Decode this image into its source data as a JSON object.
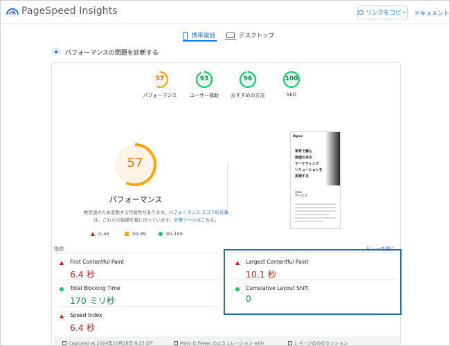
{
  "header": {
    "app_title": "PageSpeed Insights",
    "copy_link_label": "リンクをコピー",
    "docs_label": "ドキュメント"
  },
  "tabs": [
    {
      "label": "携帯電話",
      "active": true,
      "icon": "phone-icon"
    },
    {
      "label": "デスクトップ",
      "active": false,
      "icon": "desktop-icon"
    }
  ],
  "diagnose": {
    "title": "パフォーマンスの問題を診断する"
  },
  "categories": [
    {
      "score": "57",
      "label": "パフォーマンス",
      "color": "#ffa400",
      "text_color": "#e67700",
      "fraction": 0.57
    },
    {
      "score": "93",
      "label": "ユーザー補助",
      "color": "#0cce6b",
      "text_color": "#0d904f",
      "fraction": 0.93
    },
    {
      "score": "96",
      "label": "おすすめの方法",
      "color": "#0cce6b",
      "text_color": "#0d904f",
      "fraction": 0.96
    },
    {
      "score": "100",
      "label": "SEO",
      "color": "#0cce6b",
      "text_color": "#0d904f",
      "fraction": 1.0
    }
  ],
  "performance": {
    "score": "57",
    "fraction": 0.57,
    "label": "パフォーマンス",
    "note_text": "推定値のため変動する可能性があります。",
    "note_link1": "パフォーマンス スコアの計算",
    "note_text2": "は、これらの指標を基に行っています。",
    "note_link2": "計算ツールはこちら。"
  },
  "legend": [
    {
      "range": "0–49",
      "shape": "triangle",
      "color": "#eb0f00"
    },
    {
      "range": "50–89",
      "shape": "square",
      "color": "#ffa400"
    },
    {
      "range": "90–100",
      "shape": "circle",
      "color": "#0cce6b"
    }
  ],
  "screenshot": {
    "brand": "Bigme",
    "headline": [
      "世界で最も",
      "価値のある",
      "マーケティング",
      "ソリューションを",
      "実現する"
    ],
    "section_title": "サービス"
  },
  "metrics_section": {
    "label": "指標",
    "expand_label": "ビューを開く"
  },
  "metrics": [
    {
      "name": "First Contentful Paint",
      "value": "6.4 秒",
      "status": "fail"
    },
    {
      "name": "Largest Contentful Paint",
      "value": "10.1 秒",
      "status": "fail"
    },
    {
      "name": "Total Blocking Time",
      "value": "170 ミリ秒",
      "status": "pass"
    },
    {
      "name": "Cumulative Layout Shift",
      "value": "0",
      "status": "pass"
    },
    {
      "name": "Speed Index",
      "value": "6.4 秒",
      "status": "fail"
    }
  ],
  "footer": {
    "captured": "Captured at 2024年10月18日 8:25 JST",
    "device": "Moto G Power のエミュレーション with",
    "session": "1 ページのみのセッション"
  }
}
